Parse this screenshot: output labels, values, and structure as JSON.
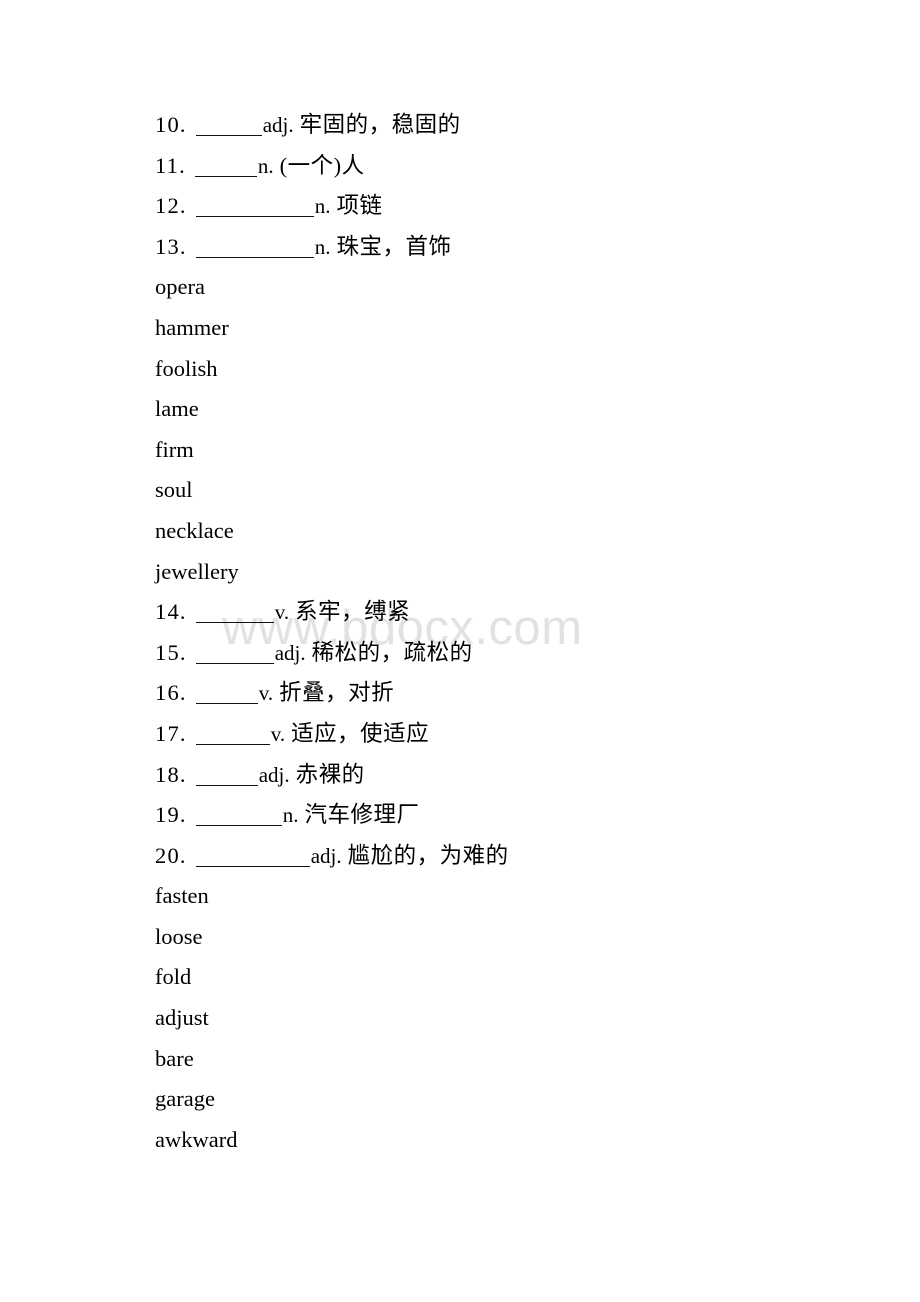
{
  "document": {
    "watermark": "www.bdocx.com",
    "page_background": "#ffffff",
    "text_color": "#000000",
    "watermark_color": "#e2e2e2"
  },
  "blocks": [
    {
      "type": "numbered_list",
      "items": [
        {
          "number": "10.",
          "blank_width": 66,
          "pos": "adj.",
          "meaning": "牢固的，稳固的"
        },
        {
          "number": "11.",
          "blank_width": 62,
          "pos": "n.",
          "meaning": "(一个)人"
        },
        {
          "number": "12.",
          "blank_width": 118,
          "pos": "n.",
          "meaning": "项链"
        },
        {
          "number": "13.",
          "blank_width": 118,
          "pos": "n.",
          "meaning": "珠宝，首饰"
        }
      ]
    },
    {
      "type": "word_list",
      "words": [
        "opera",
        "hammer",
        "foolish",
        "lame",
        "firm",
        "soul",
        "necklace",
        "jewellery"
      ]
    },
    {
      "type": "numbered_list",
      "items": [
        {
          "number": "14.",
          "blank_width": 78,
          "pos": "v.",
          "meaning": "系牢，缚紧"
        },
        {
          "number": "15.",
          "blank_width": 78,
          "pos": "adj.",
          "meaning": "稀松的，疏松的"
        },
        {
          "number": "16.",
          "blank_width": 62,
          "pos": "v.",
          "meaning": "折叠，对折"
        },
        {
          "number": "17.",
          "blank_width": 74,
          "pos": "v.",
          "meaning": "适应，使适应"
        },
        {
          "number": "18.",
          "blank_width": 62,
          "pos": "adj.",
          "meaning": "赤裸的"
        },
        {
          "number": "19.",
          "blank_width": 86,
          "pos": "n.",
          "meaning": "汽车修理厂"
        },
        {
          "number": "20.",
          "blank_width": 114,
          "pos": "adj.",
          "meaning": "尴尬的，为难的"
        }
      ]
    },
    {
      "type": "word_list",
      "words": [
        "fasten",
        "loose",
        "fold",
        "adjust",
        "bare",
        "garage",
        "awkward"
      ]
    }
  ]
}
